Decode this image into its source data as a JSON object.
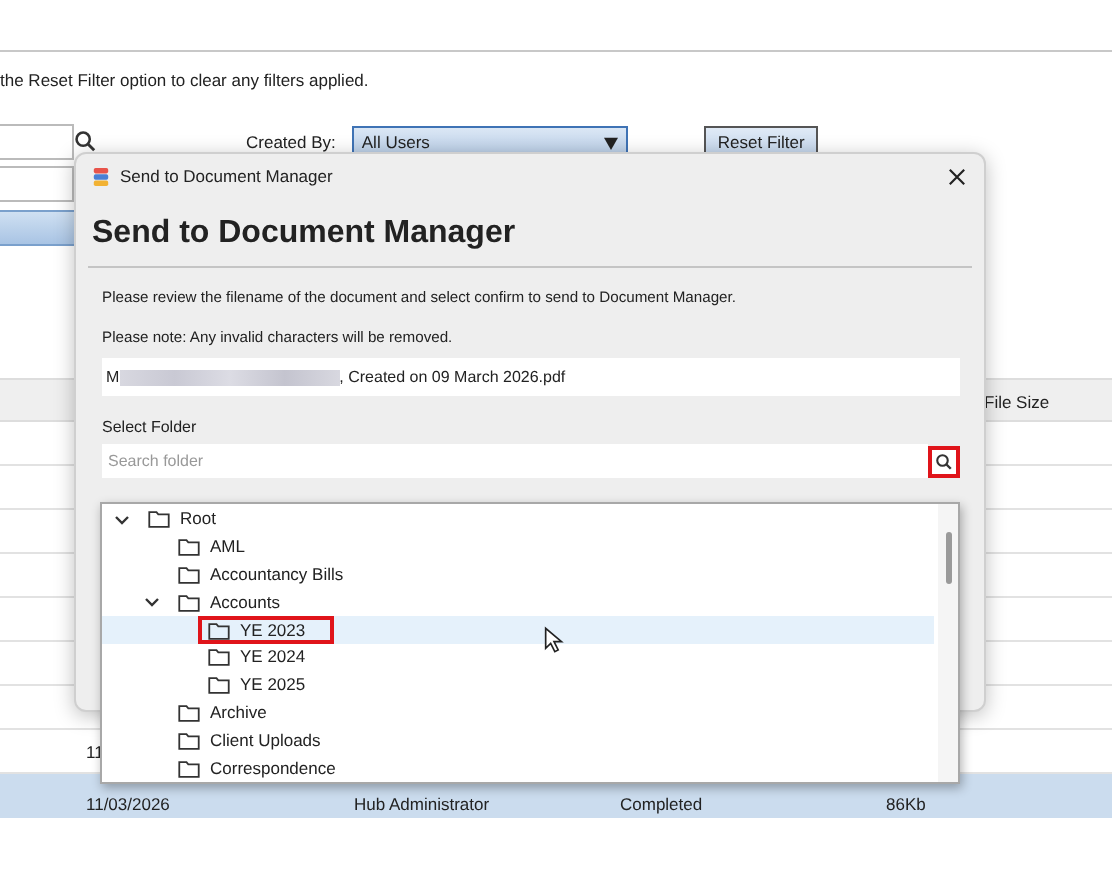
{
  "page": {
    "hint": "the Reset Filter option to clear any filters applied.",
    "created_by_label": "Created By:",
    "created_by": "All Users",
    "reset_button": "Reset Filter"
  },
  "table": {
    "columns": [
      "File Size"
    ],
    "rows": [
      {
        "cells": [
          "11"
        ],
        "selected": false
      },
      {
        "cells": [
          "11/03/2026",
          "Hub Administrator",
          "Completed",
          "86Kb"
        ],
        "selected": true
      }
    ]
  },
  "dialog": {
    "title": "Send to Document Manager",
    "heading": "Send to Document Manager",
    "messages": [
      "Please review the filename of the document and select confirm to send to Document Manager.",
      "Please note: Any invalid characters will be removed."
    ],
    "filename": {
      "prefix": "M",
      "suffix": ", Created on 09 March 2026.pdf"
    },
    "folder_label": "Select Folder",
    "search": {
      "placeholder": "Search folder",
      "marked": true
    },
    "tree": [
      {
        "label": "Root",
        "expanded": true,
        "hovered": false,
        "marked": false,
        "children": [
          {
            "label": "AML",
            "hovered": false,
            "marked": false
          },
          {
            "label": "Accountancy Bills",
            "hovered": false,
            "marked": false
          },
          {
            "label": "Accounts",
            "expanded": true,
            "hovered": false,
            "marked": false,
            "children": [
              {
                "label": "YE 2023",
                "hovered": true,
                "marked": true
              },
              {
                "label": "YE 2024",
                "hovered": false,
                "marked": false
              },
              {
                "label": "YE 2025",
                "hovered": false,
                "marked": false
              }
            ]
          },
          {
            "label": "Archive",
            "hovered": false,
            "marked": false
          },
          {
            "label": "Client Uploads",
            "hovered": false,
            "marked": false
          },
          {
            "label": "Correspondence",
            "hovered": false,
            "marked": false
          }
        ]
      }
    ]
  }
}
